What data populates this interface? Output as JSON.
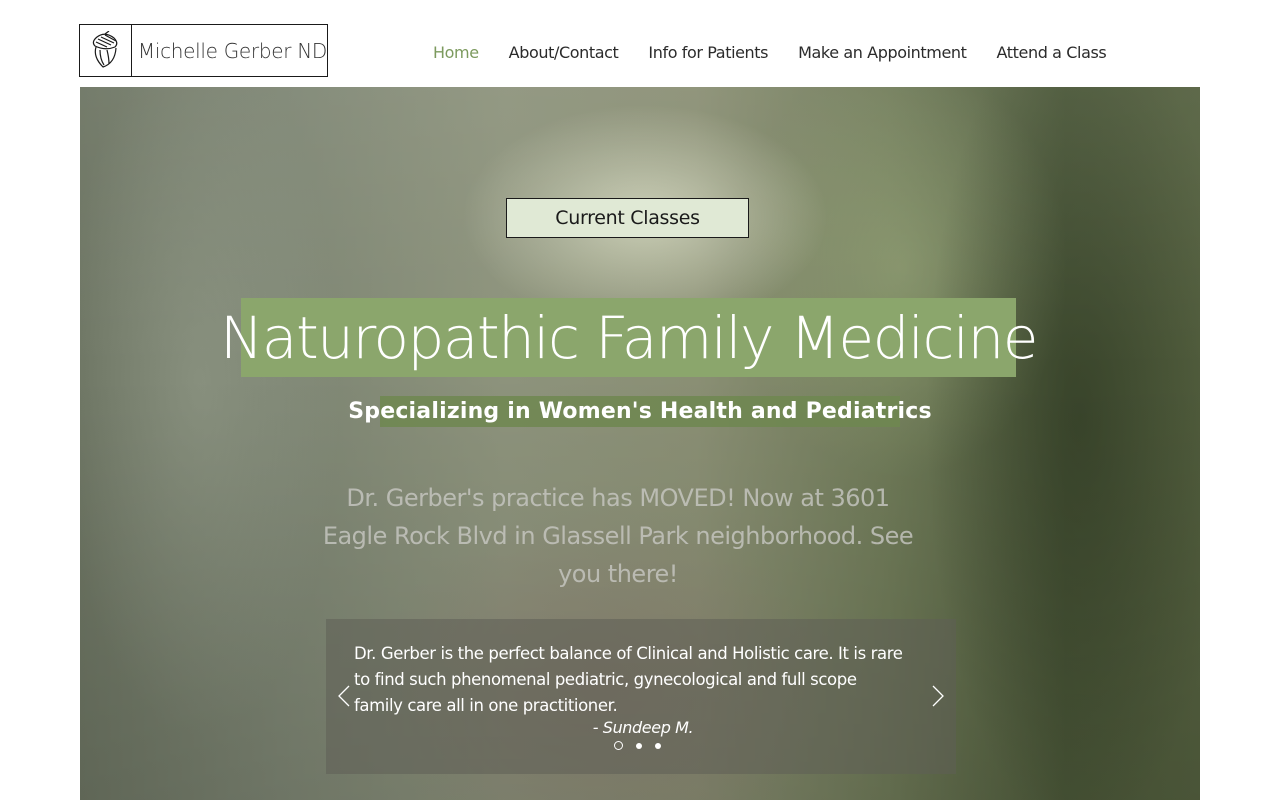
{
  "header": {
    "logo_text": "Michelle Gerber ND",
    "logo_icon": "acorn-icon",
    "nav": [
      {
        "label": "Home",
        "active": true
      },
      {
        "label": "About/Contact",
        "active": false
      },
      {
        "label": "Info for Patients",
        "active": false
      },
      {
        "label": "Make an Appointment",
        "active": false
      },
      {
        "label": "Attend a Class",
        "active": false
      }
    ]
  },
  "hero": {
    "classes_button": "Current Classes",
    "title": "Naturopathic Family Medicine",
    "subtitle": "Specializing in Women's Health and Pediatrics",
    "moved_notice": "Dr. Gerber's practice has MOVED!  Now at 3601 Eagle Rock Blvd in Glassell Park neighborhood.  See you there!"
  },
  "testimonial": {
    "quote": "Dr. Gerber is the perfect balance of Clinical and Holistic care. It is rare to find such phenomenal pediatric, gynecological and full scope family care all in one practitioner.",
    "author": "- Sundeep M.",
    "slides": 3,
    "active_slide": 0
  },
  "colors": {
    "accent_green": "#8ba66c",
    "nav_active": "#7c9a5e",
    "button_bg": "#e0e9d5"
  }
}
